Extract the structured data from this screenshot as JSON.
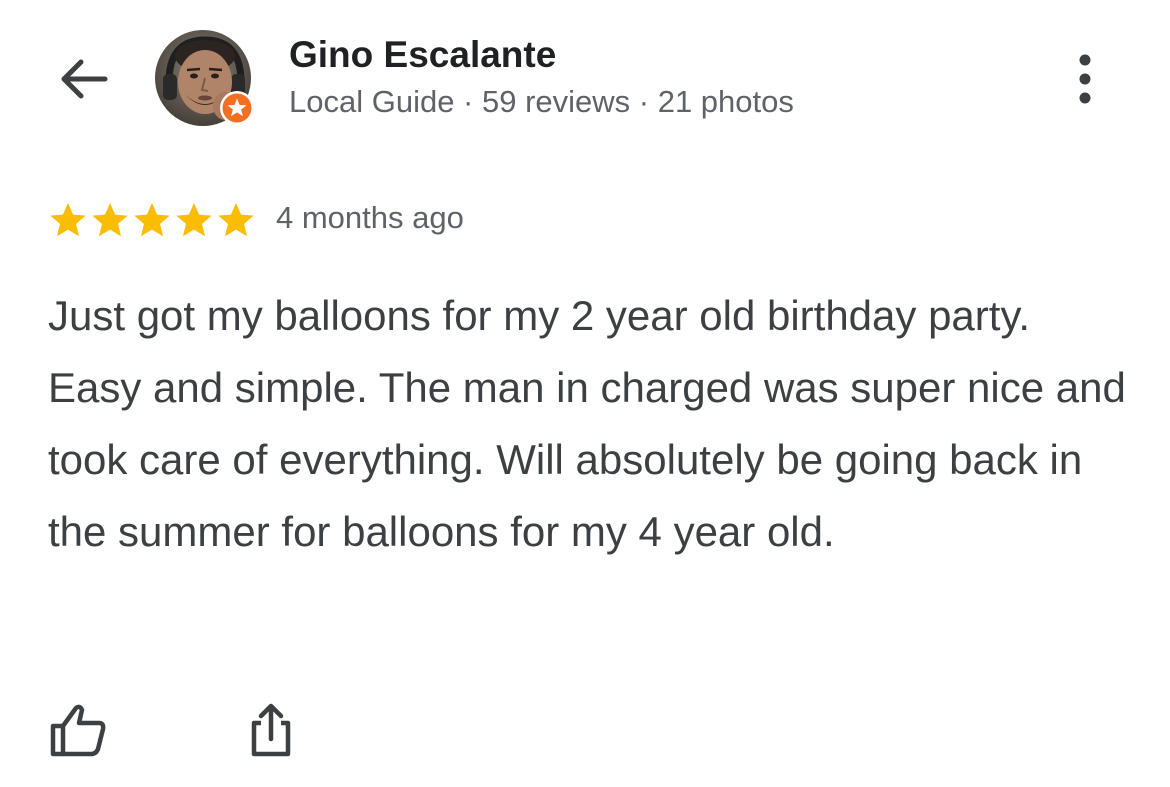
{
  "header": {
    "back_icon": "arrow-left-icon",
    "more_icon": "more-vertical-icon"
  },
  "reviewer": {
    "name": "Gino Escalante",
    "meta": "Local Guide · 59 reviews · 21 photos",
    "badge_icon": "local-guide-star-icon",
    "badge_color": "#f36f21"
  },
  "review": {
    "rating": 5,
    "max_rating": 5,
    "star_color": "#fbbc04",
    "time": "4 months ago",
    "text": "Just got my balloons for my 2 year old birthday party. Easy and simple. The man in charged was super nice and took care of everything. Will absolutely be going back in the summer for balloons for my 4 year old."
  },
  "actions": {
    "like_icon": "thumbs-up-icon",
    "share_icon": "share-icon"
  },
  "colors": {
    "primary_text": "#202124",
    "secondary_text": "#5f6368",
    "body_text": "#3c4043",
    "icon": "#3c4043"
  }
}
